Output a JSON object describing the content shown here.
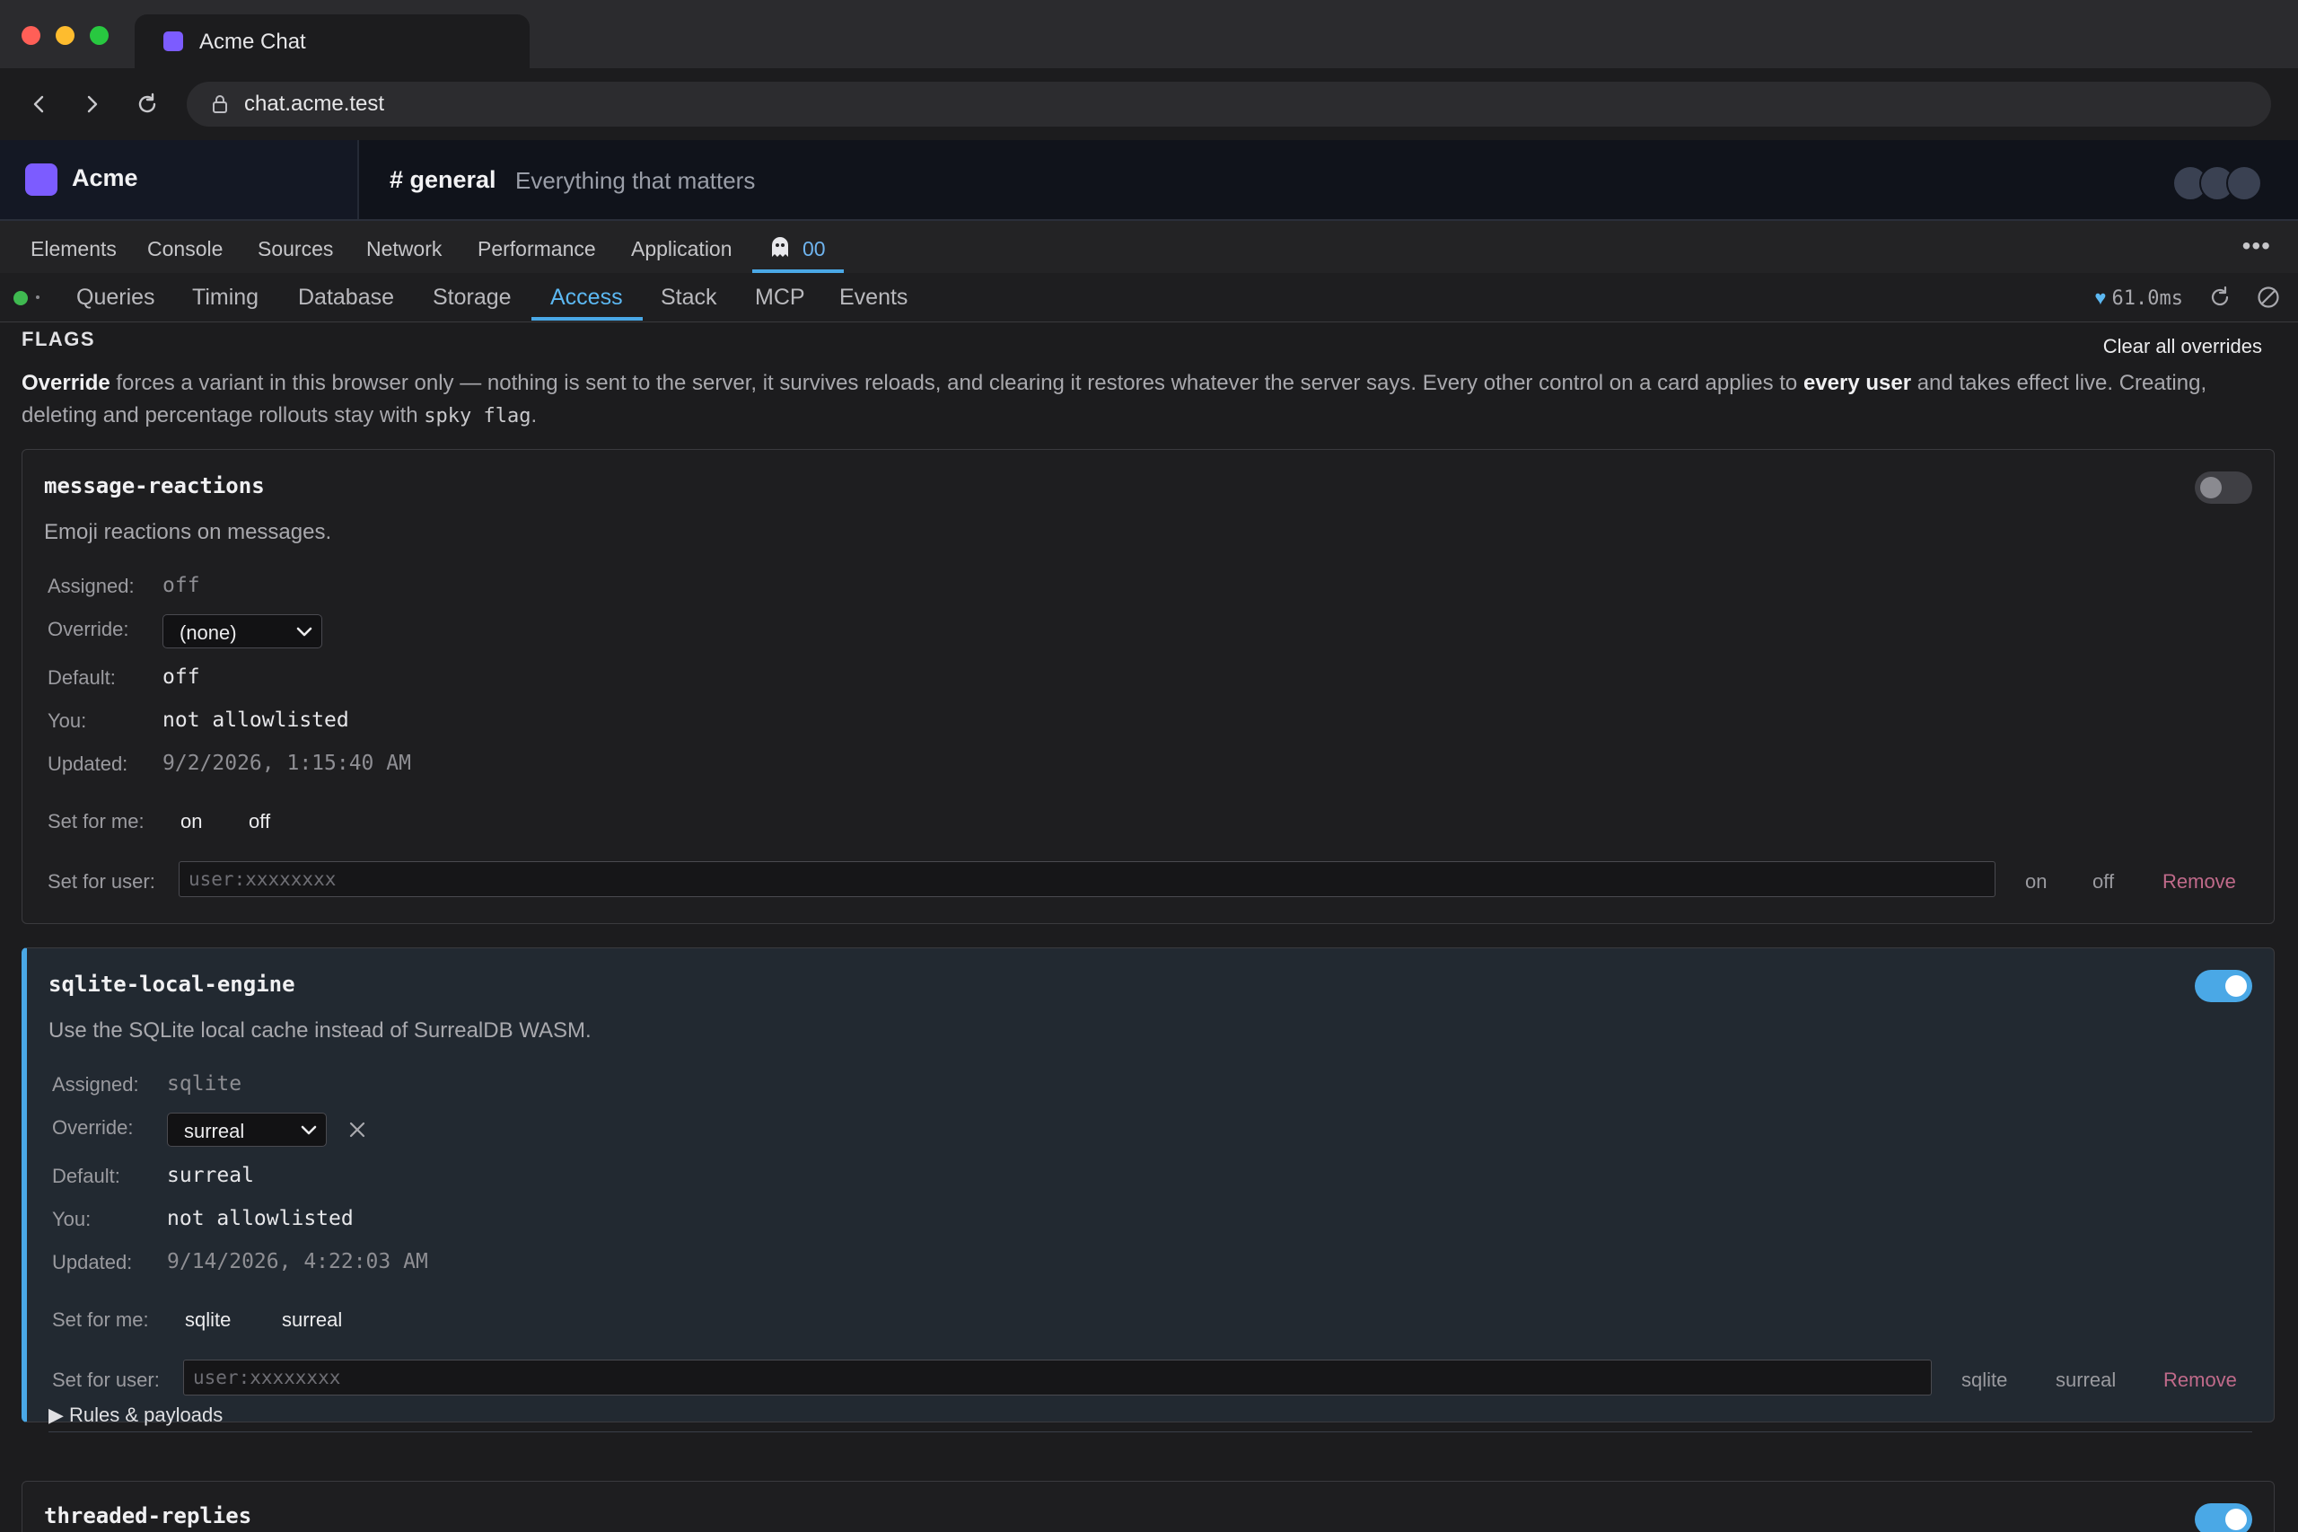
{
  "browser": {
    "tab_title": "Acme Chat",
    "url": "chat.acme.test"
  },
  "app": {
    "workspace": "Acme",
    "channel": "# general",
    "topic": "Everything that matters"
  },
  "devtools": {
    "tabs": [
      "Elements",
      "Console",
      "Sources",
      "Network",
      "Performance",
      "Application"
    ],
    "extension_count": "00",
    "more": "•••",
    "subtabs": [
      "Queries",
      "Timing",
      "Database",
      "Storage",
      "Access",
      "Stack",
      "MCP",
      "Events"
    ],
    "active_subtab": "Access",
    "timing": "61.0ms",
    "timing_heart": "♥"
  },
  "flags": {
    "title": "FLAGS",
    "clear_all": "Clear all overrides",
    "intro": {
      "b1": "Override",
      "t1": " forces a variant in this browser only — nothing is sent to the server, it survives reloads, and clearing it restores whatever the server says. Every other control on a card applies to ",
      "b2": "every user",
      "t2": " and takes effect live. Creating, deleting and percentage rollouts stay with ",
      "code": "spky flag",
      "t3": "."
    },
    "labels": {
      "assigned": "Assigned:",
      "override": "Override:",
      "default": "Default:",
      "you": "You:",
      "updated": "Updated:",
      "set_for_me": "Set for me:",
      "set_for_user": "Set for user:",
      "remove": "Remove",
      "user_placeholder": "user:xxxxxxxx",
      "rules": "Rules & payloads"
    },
    "cards": [
      {
        "name": "message-reactions",
        "description": "Emoji reactions on messages.",
        "enabled": false,
        "assigned": "off",
        "override": "(none)",
        "default": "off",
        "you": "not allowlisted",
        "updated": "9/2/2026, 1:15:40 AM",
        "variants": [
          "on",
          "off"
        ]
      },
      {
        "name": "sqlite-local-engine",
        "description": "Use the SQLite local cache instead of SurrealDB WASM.",
        "enabled": true,
        "assigned": "sqlite",
        "override": "surreal",
        "default": "surreal",
        "you": "not allowlisted",
        "updated": "9/14/2026, 4:22:03 AM",
        "variants": [
          "sqlite",
          "surreal"
        ]
      },
      {
        "name": "threaded-replies",
        "enabled": true
      }
    ]
  }
}
